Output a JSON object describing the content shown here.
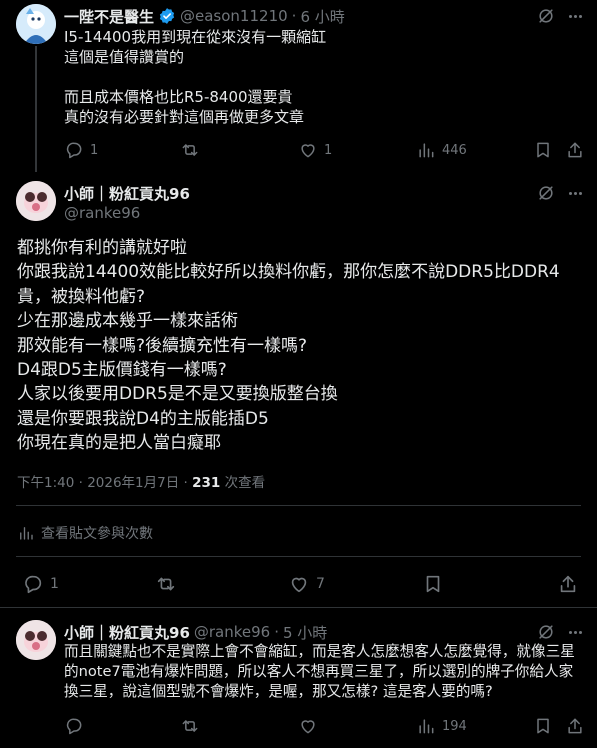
{
  "tweet1": {
    "name": "一陛不是醫生",
    "handle": "@eason11210",
    "time": "6 小時",
    "text": "I5-14400我用到現在從來沒有一顆縮缸\n這個是值得讚賞的\n\n而且成本價格也比R5-8400還要貴\n真的沒有必要針對這個再做更多文章",
    "replies": "1",
    "likes": "1",
    "views": "446"
  },
  "main": {
    "name": "小師｜粉紅貢丸96",
    "handle": "@ranke96",
    "text": "都挑你有利的講就好啦\n你跟我說14400效能比較好所以換料你虧，那你怎麼不說DDR5比DDR4貴，被換料他虧?\n少在那邊成本幾乎一樣來話術\n那效能有一樣嗎?後續擴充性有一樣嗎?\nD4跟D5主版價錢有一樣嗎?\n人家以後要用DDR5是不是又要換版整台換\n還是你要跟我說D4的主版能插D5\n你現在真的是把人當白癡耶",
    "time_date": "下午1:40 · 2026年1月7日 · ",
    "views_count": "231",
    "views_label": " 次查看",
    "analytics_label": "查看貼文參與次數",
    "replies": "1",
    "likes": "7"
  },
  "tweet3": {
    "name": "小師｜粉紅貢丸96",
    "handle": "@ranke96",
    "time": "5 小時",
    "text": "而且關鍵點也不是實際上會不會縮缸，而是客人怎麼想客人怎麼覺得，就像三星的note7電池有爆炸問題，所以客人不想再買三星了，所以選別的牌子你給人家換三星，說這個型號不會爆炸，是喔，那又怎樣? 這是客人要的嗎?",
    "views": "194"
  },
  "colors": {
    "verified": "#1d9bf0",
    "text": "#e7e9ea",
    "muted": "#71767b",
    "divider": "#2f3336"
  }
}
